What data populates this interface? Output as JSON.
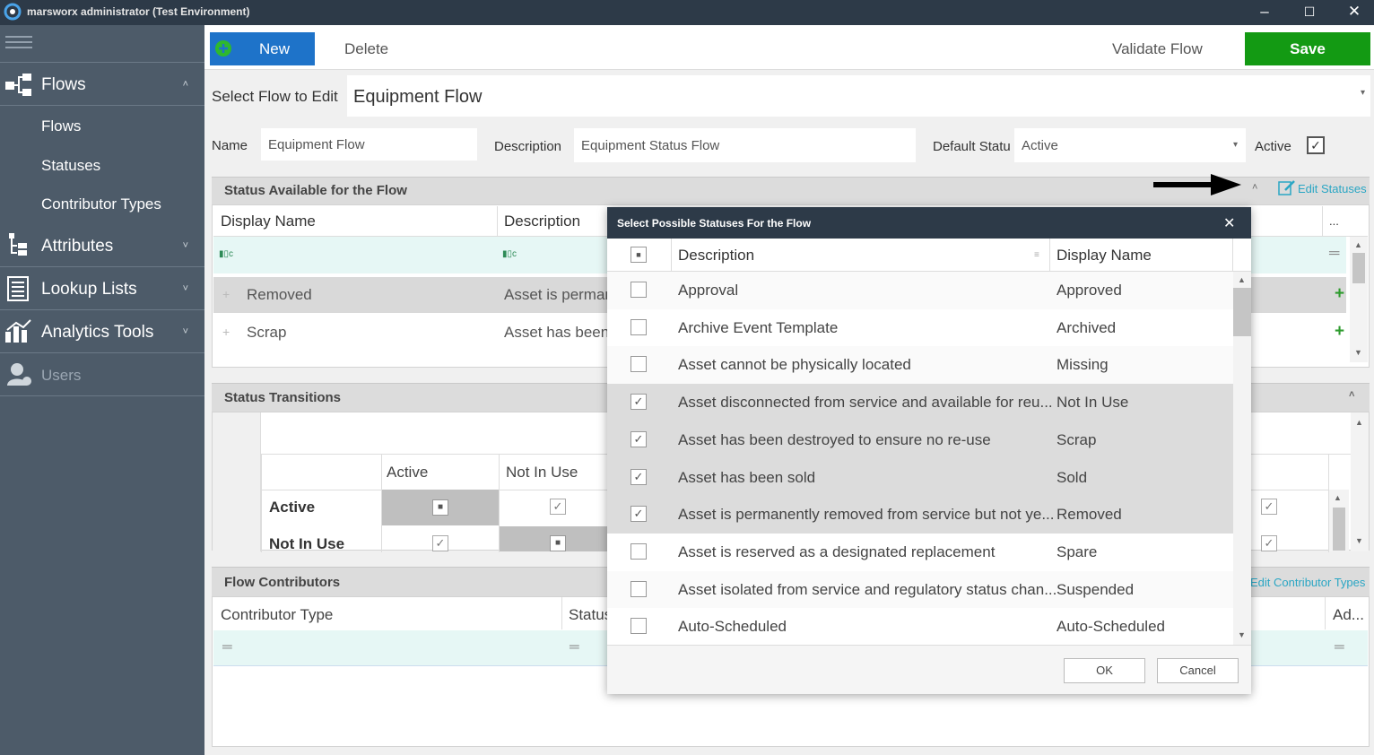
{
  "window": {
    "title": "marsworx administrator (Test Environment)",
    "min": "–",
    "max": "☐",
    "close": "✕"
  },
  "sidebar": {
    "menu_icon": "hamburger-icon",
    "sections": [
      {
        "label": "Flows",
        "icon": "flows-icon",
        "chevron": "˄"
      },
      {
        "label": "Attributes",
        "icon": "attributes-icon",
        "chevron": "˅"
      },
      {
        "label": "Lookup Lists",
        "icon": "lookup-icon",
        "chevron": "˅"
      },
      {
        "label": "Analytics Tools",
        "icon": "analytics-icon",
        "chevron": "˅"
      },
      {
        "label": "Users",
        "icon": "users-icon"
      }
    ],
    "sub_items": [
      "Flows",
      "Statuses",
      "Contributor Types"
    ]
  },
  "toolbar": {
    "new": "New",
    "delete": "Delete",
    "validate": "Validate Flow",
    "save": "Save"
  },
  "select_flow": {
    "label": "Select Flow to Edit",
    "value": "Equipment Flow"
  },
  "form": {
    "name_label": "Name",
    "name_value": "Equipment Flow",
    "desc_label": "Description",
    "desc_value": "Equipment Status Flow",
    "default_label": "Default Statu",
    "default_value": "Active",
    "active_label": "Active",
    "active_checked": "✓"
  },
  "status_section": {
    "title": "Status Available for the Flow",
    "edit_link": "Edit Statuses",
    "columns": [
      "Display Name",
      "Description"
    ],
    "more": "...",
    "rows": [
      {
        "name": "Removed",
        "desc": "Asset is perman"
      },
      {
        "name": "Scrap",
        "desc": "Asset has been"
      }
    ]
  },
  "transitions": {
    "title": "Status Transitions",
    "cols": [
      "Active",
      "Not In Use"
    ],
    "rows": [
      "Active",
      "Not In Use"
    ]
  },
  "contributors": {
    "title": "Flow Contributors",
    "edit_link": "Edit Contributor Types",
    "columns": [
      "Contributor Type",
      "Status"
    ],
    "add": "Ad..."
  },
  "dialog": {
    "title": "Select Possible Statuses For the Flow",
    "close": "✕",
    "col_desc": "Description",
    "col_name": "Display Name",
    "rows": [
      {
        "desc": "Approval",
        "name": "Approved",
        "checked": false
      },
      {
        "desc": "Archive Event Template",
        "name": "Archived",
        "checked": false
      },
      {
        "desc": "Asset cannot be physically located",
        "name": "Missing",
        "checked": false
      },
      {
        "desc": "Asset disconnected  from service and available for reu...",
        "name": "Not In Use",
        "checked": true
      },
      {
        "desc": "Asset has been destroyed to ensure no re-use",
        "name": "Scrap",
        "checked": true
      },
      {
        "desc": "Asset has been sold",
        "name": "Sold",
        "checked": true
      },
      {
        "desc": "Asset is permanently removed from service but not ye...",
        "name": "Removed",
        "checked": true
      },
      {
        "desc": "Asset is reserved as a designated replacement",
        "name": "Spare",
        "checked": false
      },
      {
        "desc": "Asset isolated from service and regulatory status chan...",
        "name": "Suspended",
        "checked": false
      },
      {
        "desc": "Auto-Scheduled",
        "name": "Auto-Scheduled",
        "checked": false
      }
    ],
    "ok": "OK",
    "cancel": "Cancel"
  }
}
